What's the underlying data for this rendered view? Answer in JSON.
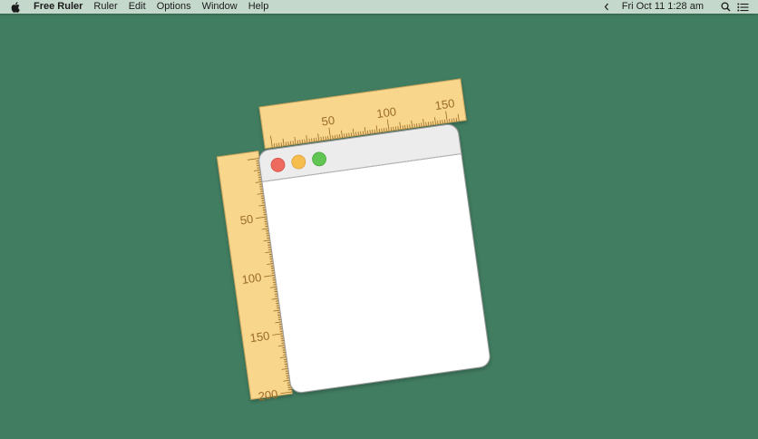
{
  "menubar": {
    "apple_icon": "apple-logo-icon",
    "app_name": "Free Ruler",
    "items": [
      "Ruler",
      "Edit",
      "Options",
      "Window",
      "Help"
    ],
    "status": {
      "chevron_icon": "chevron-left-icon",
      "clock": "Fri Oct 11  1:28 am",
      "search_icon": "search-icon",
      "list_icon": "notification-list-icon"
    }
  },
  "illustration": {
    "horizontal_ruler": {
      "labels": [
        "50",
        "100",
        "150"
      ],
      "color": "#f8d68c"
    },
    "vertical_ruler": {
      "labels": [
        "50",
        "100",
        "150",
        "200"
      ],
      "color": "#f8d68c"
    },
    "window": {
      "buttons": [
        {
          "name": "close",
          "color": "#ee6a5f"
        },
        {
          "name": "minimize",
          "color": "#f5be4f"
        },
        {
          "name": "zoom",
          "color": "#61c554"
        }
      ]
    }
  },
  "colors": {
    "desktop": "#417d61",
    "menubar": "#c4d9cc",
    "ruler_tick": "#9a6a2a"
  }
}
